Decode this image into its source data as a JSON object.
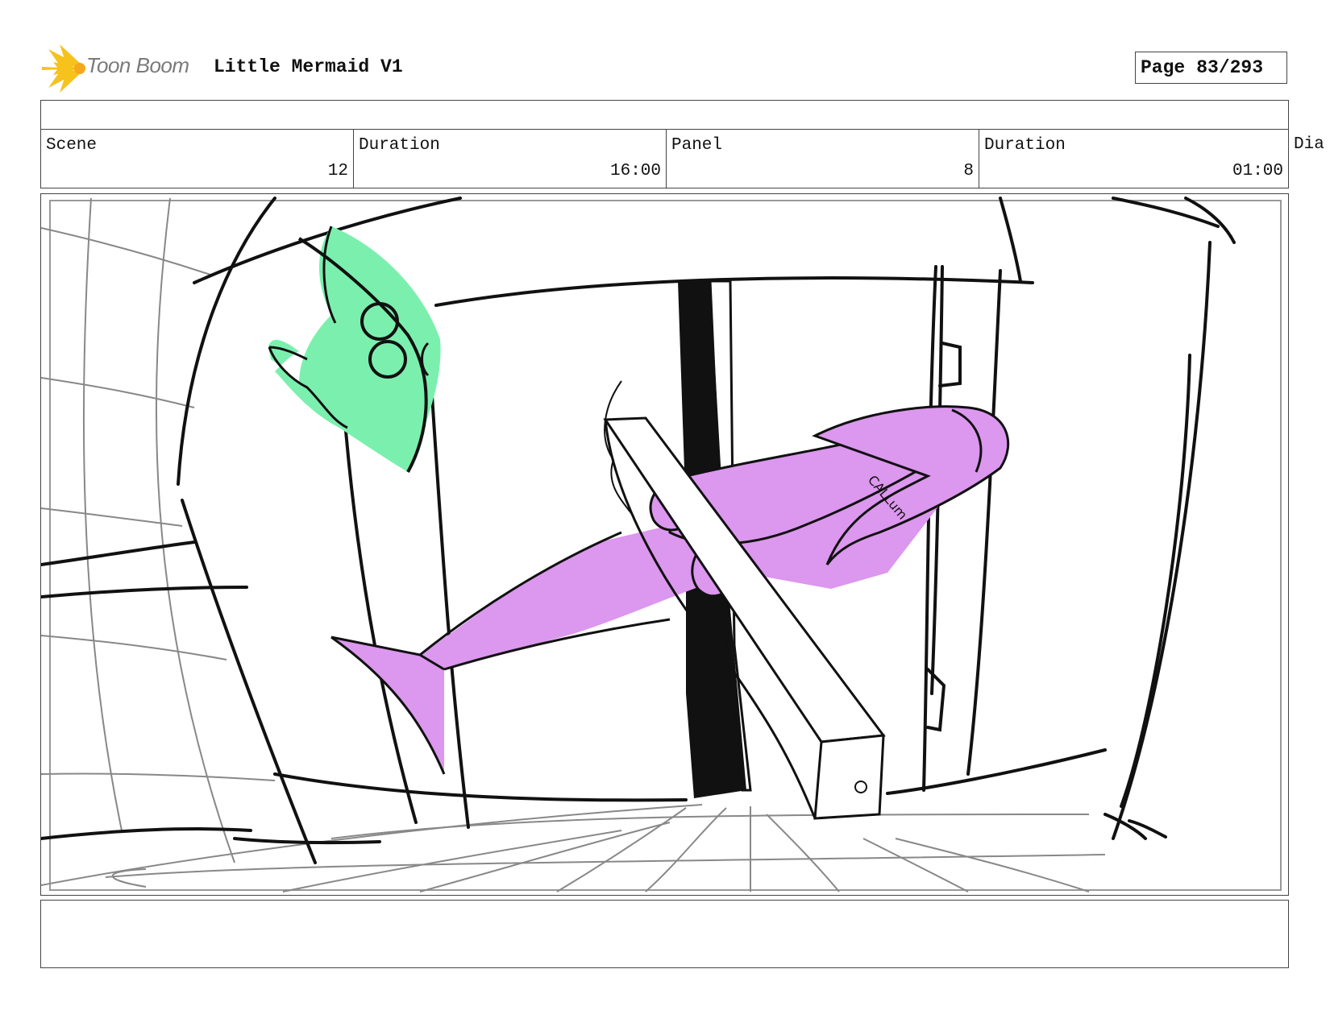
{
  "header": {
    "logo_text": "Toon Boom",
    "project_title": "Little Mermaid V1",
    "page_label": "Page",
    "page_value": "83/293"
  },
  "info": {
    "scene_label": "Scene",
    "scene_value": "12",
    "scene_duration_label": "Duration",
    "scene_duration_value": "16:00",
    "panel_label": "Panel",
    "panel_value": "8",
    "panel_duration_label": "Duration",
    "panel_duration_value": "01:00",
    "dialogue_label": "Dia"
  },
  "drawing": {
    "tattoo_text": "CALLum",
    "colors": {
      "fish": "#7bf0ae",
      "mermaid": "#dc97ee",
      "logo": "#f6c21b"
    }
  },
  "notes": {
    "text": ""
  }
}
